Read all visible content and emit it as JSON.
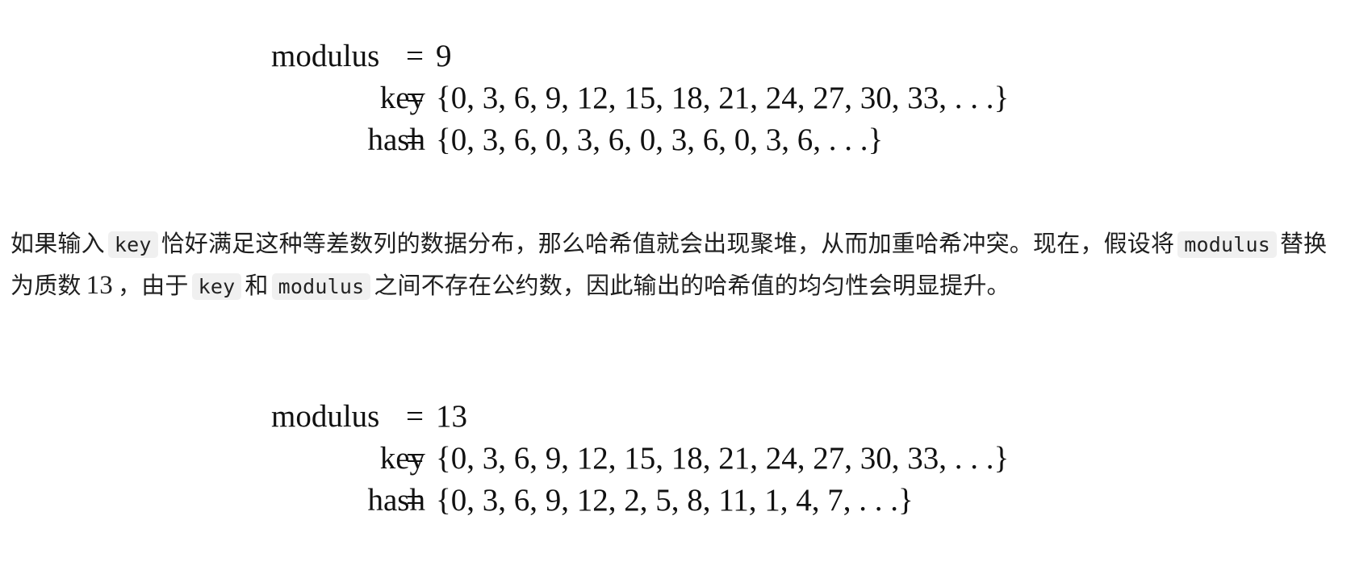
{
  "block1": {
    "modulus_lhs": "modulus",
    "modulus_eq": "=",
    "modulus_rhs": "9",
    "key_lhs": "key",
    "key_eq": "=",
    "key_rhs": "{0, 3, 6, 9, 12, 15, 18, 21, 24, 27, 30, 33, . . .}",
    "hash_lhs": "hash",
    "hash_eq": "=",
    "hash_rhs": "{0, 3, 6, 0, 3, 6, 0, 3, 6, 0, 3, 6, . . .}"
  },
  "paragraph": {
    "part1": "如果输入",
    "code_key_1": "key",
    "part2": "恰好满足这种等差数列的数据分布，那么哈希值就会出现聚堆，从而加重哈希冲突。现在，假设将",
    "code_modulus_1": "modulus",
    "part3": "替换为质数",
    "number_13": "13",
    "part4": "，由于",
    "code_key_2": "key",
    "part5": "和",
    "code_modulus_2": "modulus",
    "part6": "之间不存在公约数，因此输出的哈希值的均匀性会明显提升。"
  },
  "block2": {
    "modulus_lhs": "modulus",
    "modulus_eq": "=",
    "modulus_rhs": "13",
    "key_lhs": "key",
    "key_eq": "=",
    "key_rhs": "{0, 3, 6, 9, 12, 15, 18, 21, 24, 27, 30, 33, . . .}",
    "hash_lhs": "hash",
    "hash_eq": "=",
    "hash_rhs": "{0, 3, 6, 9, 12, 2, 5, 8, 11, 1, 4, 7, . . .}"
  }
}
